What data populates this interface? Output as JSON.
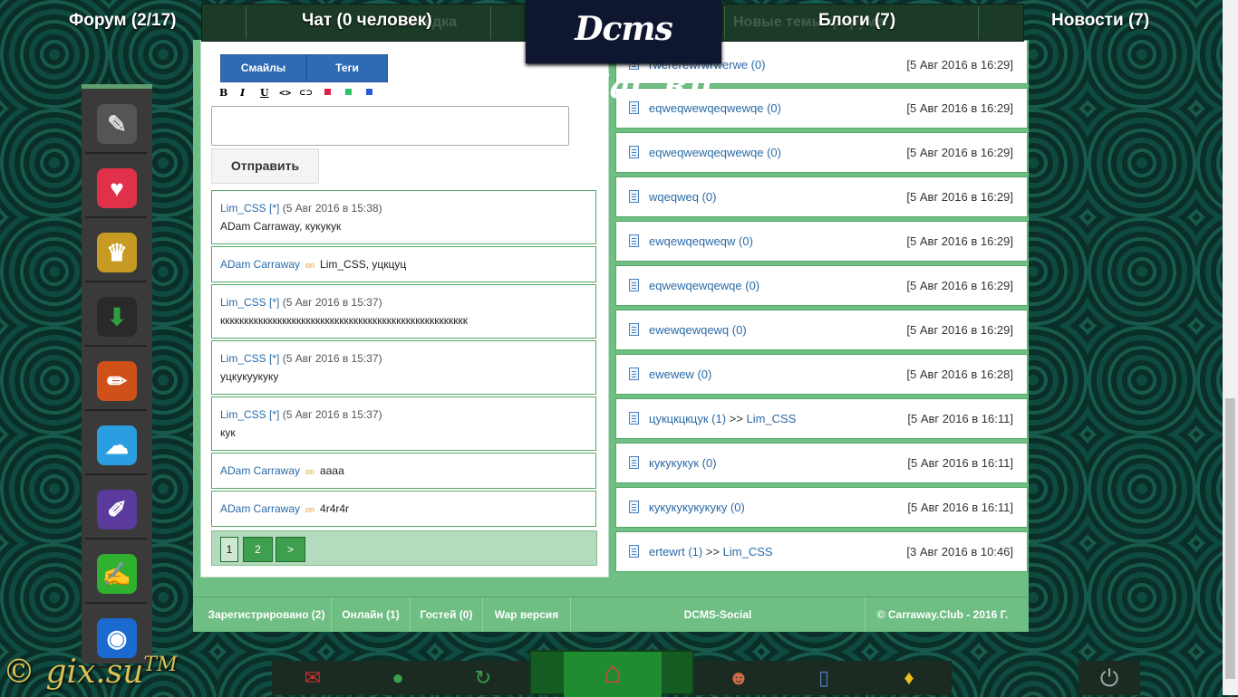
{
  "topnav": {
    "forum": "Форум (2/17)",
    "chat": "Чат (0 человек)",
    "blogs": "Блоги (7)",
    "news": "Новости (7)",
    "ghost_left": "Беседка",
    "ghost_right": "Новые темы форума"
  },
  "logo": "Dcms Social .Ru",
  "editor": {
    "smiles_label": "Смайлы",
    "tags_label": "Теги",
    "format": {
      "bold": "B",
      "italic": "I",
      "underline": "U",
      "code": "<>",
      "link": "⊂⊃"
    },
    "send_label": "Отправить"
  },
  "messages": [
    {
      "author": "Lim_CSS",
      "mark": "[*]",
      "meta": "(5 Авг 2016 в 15:38)",
      "text": "ADam Carraway, кукукук"
    },
    {
      "author": "ADam Carraway",
      "status": "on",
      "text": "Lim_CSS, уцкцуц"
    },
    {
      "author": "Lim_CSS",
      "mark": "[*]",
      "meta": "(5 Авг 2016 в 15:37)",
      "text": "кккккккккккккккккккккккккккккккккккккккккккккккккккк"
    },
    {
      "author": "Lim_CSS",
      "mark": "[*]",
      "meta": "(5 Авг 2016 в 15:37)",
      "text": "уцкукуукуку"
    },
    {
      "author": "Lim_CSS",
      "mark": "[*]",
      "meta": "(5 Авг 2016 в 15:37)",
      "text": "кук"
    },
    {
      "author": "ADam Carraway",
      "status": "on",
      "text": "аааа"
    },
    {
      "author": "ADam Carraway",
      "status": "on",
      "text": "4r4r4r"
    }
  ],
  "pager": {
    "current": "1",
    "next_page": "2",
    "next": ">"
  },
  "topics": [
    {
      "title": "rwererewrwrwerwe (0)",
      "date": "[5 Авг 2016 в 16:29]"
    },
    {
      "title": "eqweqwewqeqwewqe (0)",
      "date": "[5 Авг 2016 в 16:29]"
    },
    {
      "title": "eqweqwewqeqwewqe (0)",
      "date": "[5 Авг 2016 в 16:29]"
    },
    {
      "title": "wqeqweq (0)",
      "date": "[5 Авг 2016 в 16:29]"
    },
    {
      "title": "ewqewqeqweqw (0)",
      "date": "[5 Авг 2016 в 16:29]"
    },
    {
      "title": "eqwewqewqewqe (0)",
      "date": "[5 Авг 2016 в 16:29]"
    },
    {
      "title": "ewewqewqewq (0)",
      "date": "[5 Авг 2016 в 16:29]"
    },
    {
      "title": "ewewew (0)",
      "date": "[5 Авг 2016 в 16:28]"
    },
    {
      "title": "цукцкцкцук (1)",
      "by": "Lim_CSS",
      "date": "[5 Авг 2016 в 16:11]"
    },
    {
      "title": "кукукукук (0)",
      "date": "[5 Авг 2016 в 16:11]"
    },
    {
      "title": "кукукукукукуку (0)",
      "date": "[5 Авг 2016 в 16:11]"
    },
    {
      "title": "ertewrt (1)",
      "by": "Lim_CSS",
      "date": "[3 Авг 2016 в 10:46]"
    }
  ],
  "by_separator": ">>",
  "footer": {
    "registered": "Зарегистрировано (2)",
    "online": "Онлайн (1)",
    "guests": "Гостей (0)",
    "wap": "Wap версия",
    "engine": "DCMS-Social",
    "copyright": "© Carraway.Club - 2016 Г."
  },
  "watermark": "© gix.su",
  "watermark_tm": "TM",
  "icons": {
    "dock": [
      "pen-icon",
      "heart-icon",
      "trophy-icon",
      "download-icon",
      "pencil-icon",
      "chat-bubbles-icon",
      "edit-box-icon",
      "notepad-icon",
      "camera-icon"
    ],
    "bottom": [
      "mail-icon",
      "globe-icon",
      "refresh-icon",
      "home-icon",
      "users-icon",
      "document-icon",
      "bell-icon",
      "power-icon"
    ]
  },
  "colors": {
    "accent_green": "#6fbe83",
    "link_blue": "#2a6aa8",
    "button_blue": "#2f6bb5",
    "online_orange": "#e0a12a"
  }
}
